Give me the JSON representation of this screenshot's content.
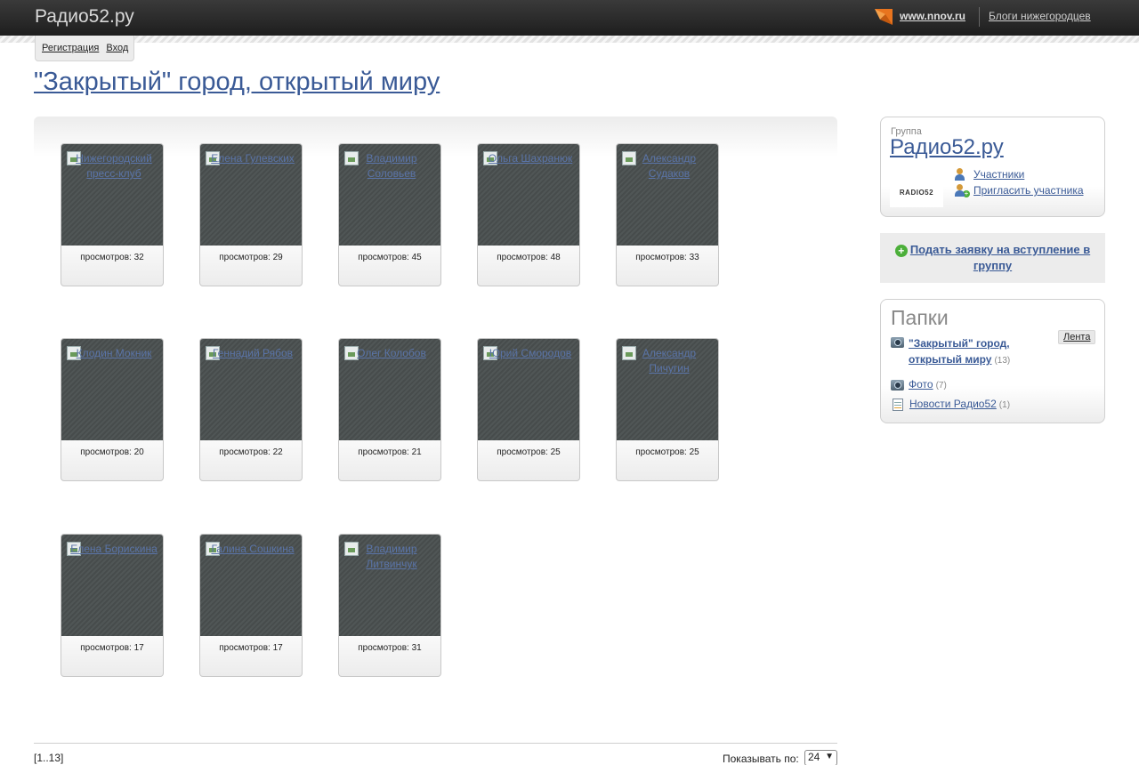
{
  "header": {
    "site_title": "Радио52.ру",
    "nnov_link": "www.nnov.ru",
    "blogs_link": "Блоги нижегородцев"
  },
  "auth": {
    "register": "Регистрация",
    "login": "Вход"
  },
  "page": {
    "title": "\"Закрытый\" город, открытый миру"
  },
  "gallery": {
    "views_prefix": "просмотров:",
    "items": [
      {
        "name": "Нижегородский пресс-клуб",
        "views": "32"
      },
      {
        "name": "Елена Гулевских",
        "views": "29"
      },
      {
        "name": "Владимир Соловьев",
        "views": "45"
      },
      {
        "name": "Ольга Шахранюк",
        "views": "48"
      },
      {
        "name": "Александр Судаков",
        "views": "33"
      },
      {
        "name": "Клодин Мокник",
        "views": "20"
      },
      {
        "name": "Геннадий Рябов",
        "views": "22"
      },
      {
        "name": "Олег Колобов",
        "views": "21"
      },
      {
        "name": "Юрий Смородов",
        "views": "25"
      },
      {
        "name": "Александр Пичугин",
        "views": "25"
      },
      {
        "name": "Елена Борискина",
        "views": "17"
      },
      {
        "name": "Галина Сошкина",
        "views": "17"
      },
      {
        "name": "Владимир Литвинчук",
        "views": "31"
      }
    ]
  },
  "pagination": {
    "range": "[1..13]",
    "show_label": "Показывать по:",
    "per_page": "24"
  },
  "sidebar": {
    "group_label": "Группа",
    "group_name": "Радио52.ру",
    "logo_text": "RADIO52",
    "members_link": "Участники",
    "invite_link": "Пригласить участника",
    "join_link": "Подать заявку на вступление в группу",
    "folders_title": "Папки",
    "feed_tab": "Лента",
    "folders": [
      {
        "name": "\"Закрытый\" город, открытый миру",
        "count": "(13)",
        "icon": "camera-icon"
      },
      {
        "name": "Фото",
        "count": "(7)",
        "icon": "camera-icon"
      },
      {
        "name": "Новости Радио52",
        "count": "(1)",
        "icon": "document-icon"
      }
    ]
  },
  "colors": {
    "link": "#3a5a96",
    "topbar": "#2a2a2a",
    "thumb": "#4a5050"
  }
}
